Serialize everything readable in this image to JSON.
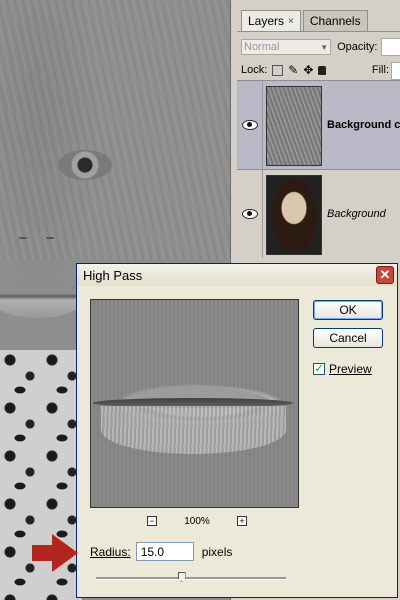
{
  "layers_panel": {
    "tabs": [
      {
        "label": "Layers",
        "close": "×"
      },
      {
        "label": "Channels"
      }
    ],
    "blend_mode": "Normal",
    "opacity_label": "Opacity:",
    "lock_label": "Lock:",
    "fill_label": "Fill:",
    "layers": [
      {
        "name": "Background co",
        "selected": true,
        "visible": true
      },
      {
        "name": "Background",
        "selected": false,
        "visible": true
      }
    ]
  },
  "dialog": {
    "title": "High Pass",
    "close_glyph": "✕",
    "ok_label": "OK",
    "cancel_label": "Cancel",
    "preview_label": "Preview",
    "preview_checked": true,
    "zoom_minus": "−",
    "zoom_value": "100%",
    "zoom_plus": "+",
    "radius_label": "Radius:",
    "radius_value": "15.0",
    "radius_unit": "pixels",
    "slider_position": 0.45
  },
  "colors": {
    "annotation_arrow": "#b3261e",
    "dialog_bg": "#ece9d8",
    "selected_layer": "#b9b9c8"
  }
}
